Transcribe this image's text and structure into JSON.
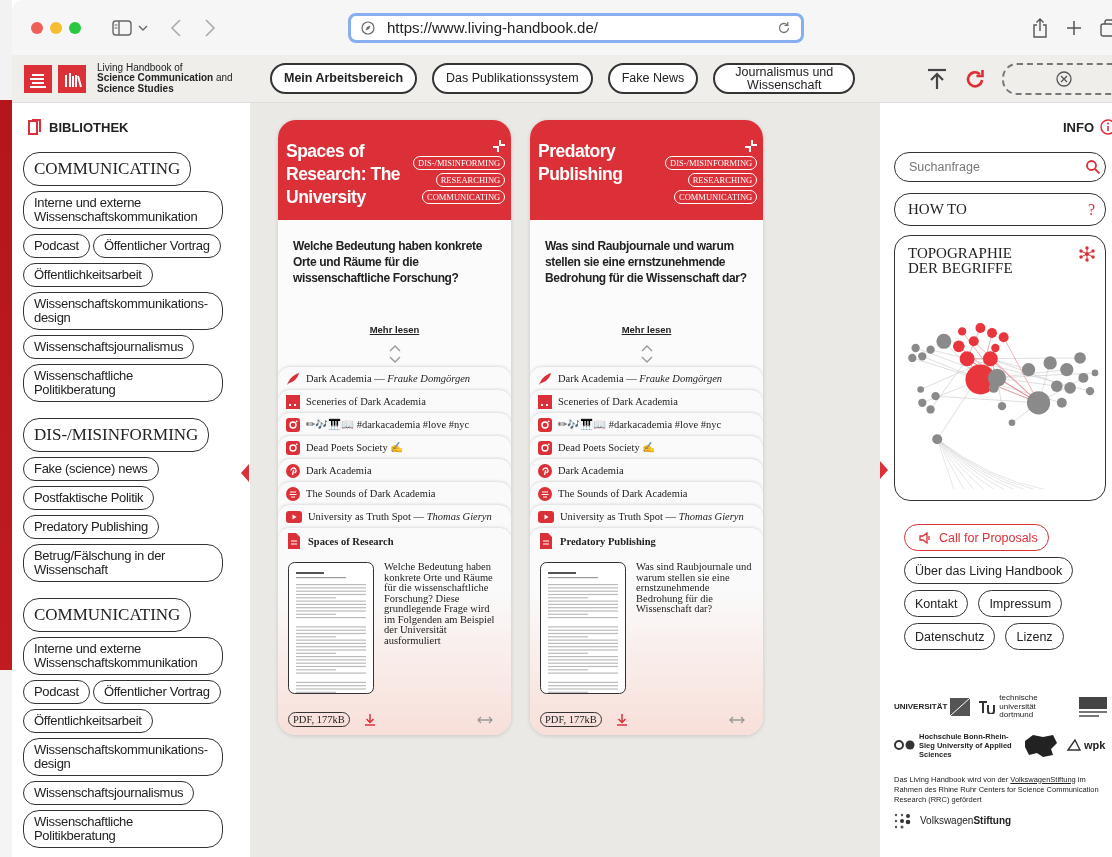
{
  "browser": {
    "url": "https://www.living-handbook.de/"
  },
  "site_header": {
    "logo_lines": [
      "Living Handbook of",
      "**Science Communication** and",
      "Science Studies"
    ],
    "nav": [
      {
        "label": "Mein Arbeitsbereich",
        "selected": true
      },
      {
        "label": "Das Publikationssystem",
        "selected": false
      },
      {
        "label": "Fake News",
        "selected": false
      },
      {
        "label": "Journalismus und Wissenschaft",
        "selected": false
      }
    ]
  },
  "sidebar": {
    "title": "BIBLIOTHEK",
    "groups": [
      {
        "heading": "COMMUNICATING",
        "items": [
          "Interne und externe Wissenschaftskommunikation",
          "Podcast",
          "Öffentlicher Vortrag",
          "Öffentlichkeitsarbeit",
          "Wissenschaftskommunikations-design",
          "Wissenschaftsjournalismus",
          "Wissenschaftliche Politikberatung"
        ]
      },
      {
        "heading": "DIS-/MISINFORMING",
        "items": [
          "Fake (science) news",
          "Postfaktische Politik",
          "Predatory Publishing",
          "Betrug/Fälschung in der Wissenschaft"
        ]
      },
      {
        "heading": "COMMUNICATING",
        "items": [
          "Interne und externe Wissenschaftskommunikation",
          "Podcast",
          "Öffentlicher Vortrag",
          "Öffentlichkeitsarbeit",
          "Wissenschaftskommunikations-design",
          "Wissenschaftsjournalismus",
          "Wissenschaftliche Politikberatung"
        ]
      }
    ]
  },
  "cards": [
    {
      "title": "Spaces of Research: The University",
      "tags": [
        "DIS-/MISINFORMING",
        "RESEARCHING",
        "COMMUNICATING"
      ],
      "question": "Welche Bedeutung haben konkrete Orte und Räume für die wissenschaftliche Forschung?",
      "more_link": "Mehr lesen",
      "resources": [
        {
          "kind": "quill",
          "text": "Dark Academia — *Frauke Domgörgen*"
        },
        {
          "kind": "square",
          "text": "Sceneries of Dark Academia"
        },
        {
          "kind": "instagram",
          "text": "✏🎶🎹📖 #darkacademia #love #nyc"
        },
        {
          "kind": "instagram",
          "text": "Dead Poets Society ✍"
        },
        {
          "kind": "pinterest",
          "text": "Dark Academia"
        },
        {
          "kind": "podcast",
          "text": "The Sounds of Dark Academia"
        },
        {
          "kind": "youtube",
          "text": "University as Truth Spot — *Thomas Gieryn*"
        }
      ],
      "document": {
        "title": "Spaces of Research",
        "description": "Welche Bedeutung haben konkrete Orte und Räume für die wissenschaftliche Forschung? Diese grundlegende Frage wird im Folgenden am Beispiel der Universität ausformuliert",
        "file_label": "PDF, 177kB"
      }
    },
    {
      "title": "Predatory Publishing",
      "tags": [
        "DIS-/MISINFORMING",
        "RESEARCHING",
        "COMMUNICATING"
      ],
      "question": "Was sind Raubjournale und warum stellen sie eine ernstzunehmende Bedrohung für die Wissenschaft dar?",
      "more_link": "Mehr lesen",
      "resources": [
        {
          "kind": "quill",
          "text": "Dark Academia — *Frauke Domgörgen*"
        },
        {
          "kind": "square",
          "text": "Sceneries of Dark Academia"
        },
        {
          "kind": "instagram",
          "text": "✏🎶🎹📖 #darkacademia #love #nyc"
        },
        {
          "kind": "instagram",
          "text": "Dead Poets Society ✍"
        },
        {
          "kind": "pinterest",
          "text": "Dark Academia"
        },
        {
          "kind": "podcast",
          "text": "The Sounds of Dark Academia"
        },
        {
          "kind": "youtube",
          "text": "University as Truth Spot — *Thomas Gieryn*"
        }
      ],
      "document": {
        "title": "Predatory Publishing",
        "description": "Was sind Raubjournale und warum stellen sie eine ernstzunehmende Bedrohung für die Wissenschaft dar?",
        "file_label": "PDF, 177kB"
      }
    }
  ],
  "info_panel": {
    "title": "INFO",
    "search": {
      "placeholder": "Suchanfrage"
    },
    "howto": {
      "label": "HOW TO",
      "mark": "?"
    },
    "topography": {
      "title": "TOPOGRAPHIE DER BEGRIFFE"
    },
    "links": [
      {
        "label": "Call for Proposals",
        "kind": "highlight"
      },
      {
        "label": "Über das Living Handbook",
        "kind": "plain"
      },
      {
        "label": "Kontakt",
        "kind": "plain"
      },
      {
        "label": "Impressum",
        "kind": "plain"
      },
      {
        "label": "Datenschutz",
        "kind": "plain"
      },
      {
        "label": "Lizenz",
        "kind": "plain"
      }
    ],
    "partner_logos": [
      {
        "kind": "uni",
        "text": "UNIVERSITÄT"
      },
      {
        "kind": "tu",
        "text": "technische universität dortmund"
      },
      {
        "kind": "kwi"
      },
      {
        "kind": "hbrs",
        "text": "Hochschule Bonn-Rhein-Sieg University of Applied Sciences"
      },
      {
        "kind": "blob"
      },
      {
        "kind": "wpk",
        "text": "wpk"
      }
    ],
    "funding_note": {
      "before": "Das Living Handbook wird von der ",
      "link": "VolkswagenStiftung",
      "after": " im Rahmen des Rhine Ruhr Centers for Science Communication Research (RRC) gefördert"
    },
    "funder_logo": "Volkswagen**Stiftung**"
  }
}
